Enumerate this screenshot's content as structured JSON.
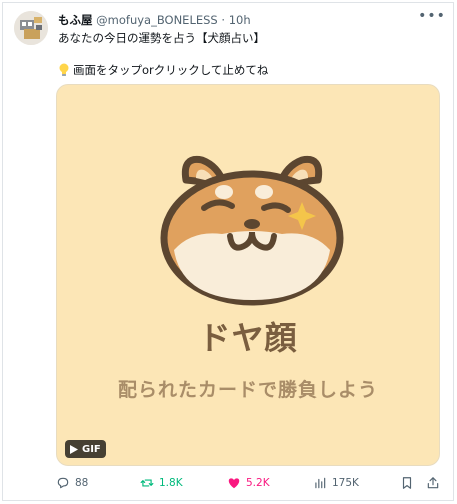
{
  "tweet": {
    "author_name": "もふ屋",
    "author_handle": "@mofuya_BONELESS",
    "separator": "·",
    "time": "10h",
    "text_line1": "あなたの今日の運勢を占う【犬顔占い】",
    "text_line2": "画面をタップorクリックして止めてね"
  },
  "media": {
    "title": "ドヤ顔",
    "subtitle": "配られたカードで勝負しよう",
    "badge": "GIF",
    "background": "#fce6b6"
  },
  "actions": {
    "reply_count": "88",
    "retweet_count": "1.8K",
    "like_count": "5.2K",
    "view_count": "175K"
  },
  "colors": {
    "retweet": "#00ba7c",
    "like": "#f91880",
    "muted": "#536471"
  }
}
